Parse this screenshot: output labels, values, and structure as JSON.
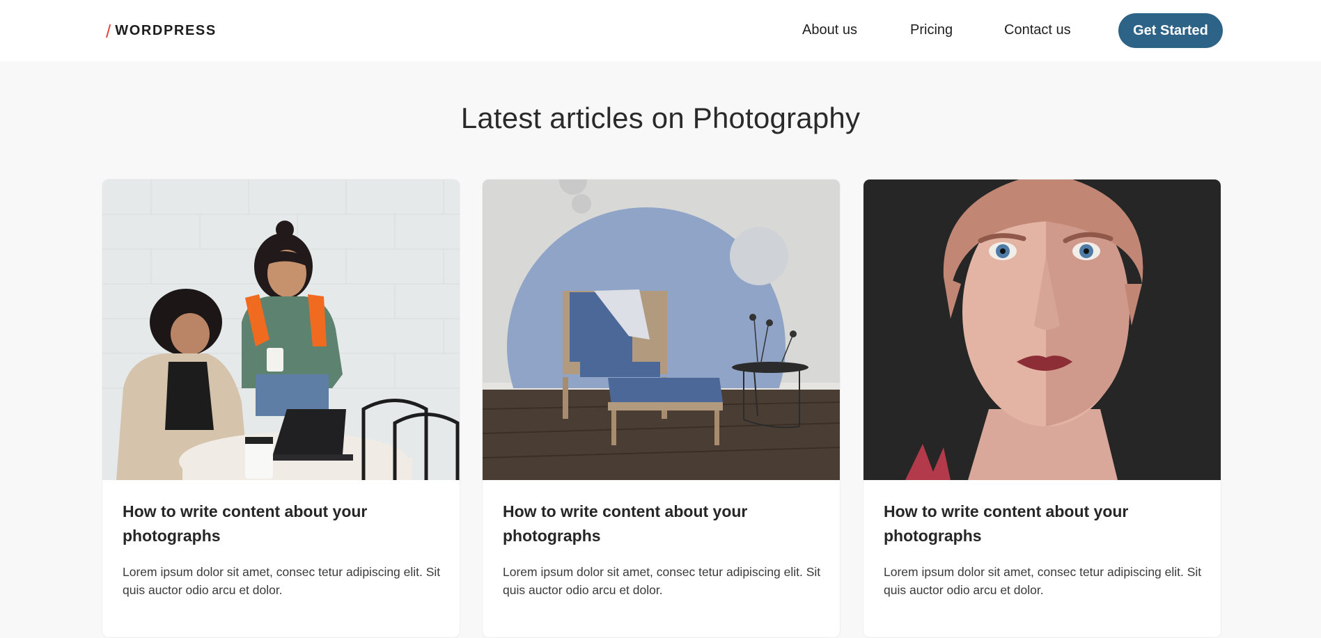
{
  "header": {
    "logo_text": "WORDPRESS",
    "nav": [
      {
        "label": "About us"
      },
      {
        "label": "Pricing"
      },
      {
        "label": "Contact us"
      }
    ],
    "cta_label": "Get Started"
  },
  "main": {
    "title": "Latest articles on Photography",
    "cards": [
      {
        "title": "How to write content about your photographs",
        "description": "Lorem ipsum dolor sit amet, consec tetur adipiscing elit. Sit quis auctor odio arcu et dolor.",
        "image": "two-people-with-laptop-photo"
      },
      {
        "title": "How to write content about your photographs",
        "description": "Lorem ipsum dolor sit amet, consec tetur adipiscing elit. Sit quis auctor odio arcu et dolor.",
        "image": "blue-armchair-interior-photo"
      },
      {
        "title": "How to write content about your photographs",
        "description": "Lorem ipsum dolor sit amet, consec tetur adipiscing elit. Sit quis auctor odio arcu et dolor.",
        "image": "3d-face-render-photo"
      }
    ]
  },
  "colors": {
    "accent": "#2e6388",
    "logo_slash": "#e2463f",
    "page_bg": "#f8f8f8"
  }
}
